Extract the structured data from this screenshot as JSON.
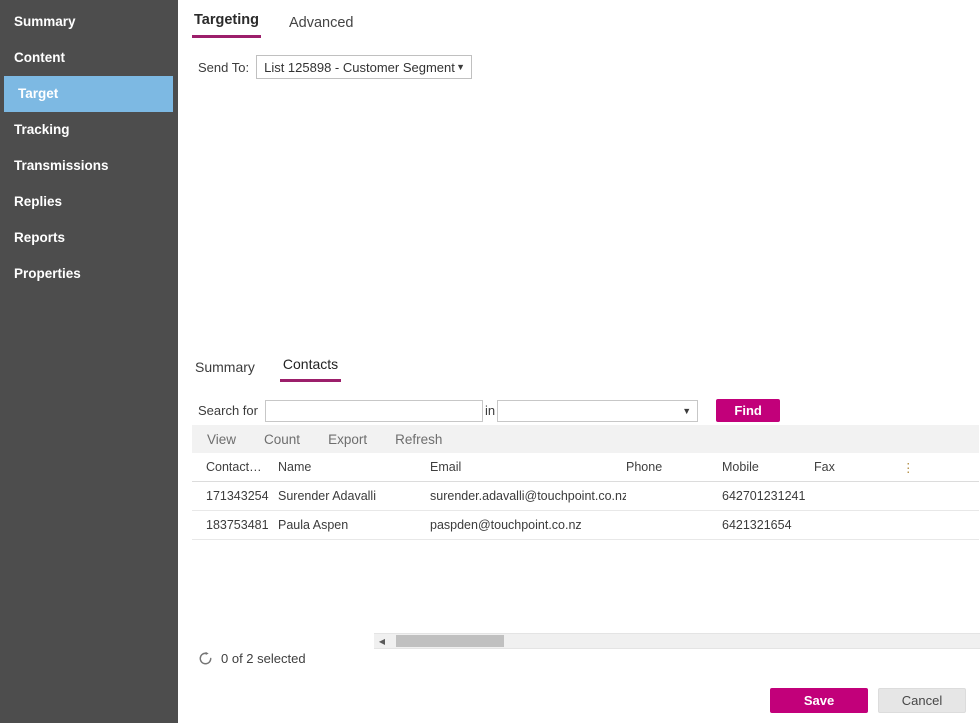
{
  "sidebar": {
    "items": [
      {
        "label": "Summary",
        "active": false
      },
      {
        "label": "Content",
        "active": false
      },
      {
        "label": "Target",
        "active": true
      },
      {
        "label": "Tracking",
        "active": false
      },
      {
        "label": "Transmissions",
        "active": false
      },
      {
        "label": "Replies",
        "active": false
      },
      {
        "label": "Reports",
        "active": false
      },
      {
        "label": "Properties",
        "active": false
      }
    ],
    "active_color": "#7db9e3",
    "background_color": "#4d4d4d"
  },
  "top_tabs": [
    {
      "label": "Targeting",
      "active": true
    },
    {
      "label": "Advanced",
      "active": false
    }
  ],
  "send_to": {
    "label": "Send To:",
    "value": "List 125898 - Customer Segment",
    "arrow_icon": "chevron-down-icon"
  },
  "sub_tabs": [
    {
      "label": "Summary",
      "active": false
    },
    {
      "label": "Contacts",
      "active": true
    }
  ],
  "search": {
    "label": "Search for",
    "value": "",
    "placeholder": "",
    "in_label": "in",
    "field_value": "",
    "field_placeholder": "",
    "find_label": "Find",
    "arrow_icon": "chevron-down-icon"
  },
  "grid_toolbar": [
    {
      "label": "View"
    },
    {
      "label": "Count"
    },
    {
      "label": "Export"
    },
    {
      "label": "Refresh"
    }
  ],
  "grid": {
    "columns": [
      {
        "key": "id",
        "label": "Contact…"
      },
      {
        "key": "name",
        "label": "Name"
      },
      {
        "key": "email",
        "label": "Email"
      },
      {
        "key": "phone",
        "label": "Phone"
      },
      {
        "key": "mobile",
        "label": "Mobile"
      },
      {
        "key": "fax",
        "label": "Fax"
      },
      {
        "key": "extra",
        "label": "⋮"
      }
    ],
    "rows": [
      {
        "id": "171343254",
        "name": "Surender Adavalli",
        "email": "surender.adavalli@touchpoint.co.nz",
        "phone": "",
        "mobile": "642701231241",
        "fax": "",
        "extra": ""
      },
      {
        "id": "183753481",
        "name": "Paula Aspen",
        "email": "paspden@touchpoint.co.nz",
        "phone": "",
        "mobile": "6421321654",
        "fax": "",
        "extra": ""
      }
    ]
  },
  "scrollbar": {
    "left_arrow_icon": "triangle-left-icon",
    "right_arrow_icon": "triangle-right-icon"
  },
  "status": {
    "refresh_icon": "refresh-icon",
    "text": "0 of 2 selected"
  },
  "footer": {
    "save_label": "Save",
    "cancel_label": "Cancel",
    "accent_color": "#c2007a"
  }
}
